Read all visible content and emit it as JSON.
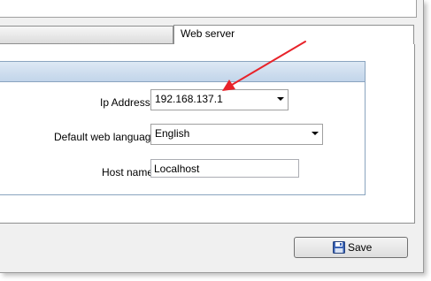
{
  "tabs": [
    {
      "label": ""
    },
    {
      "label": "Web server"
    }
  ],
  "form": {
    "ip_address": {
      "label": "Ip Address",
      "value": "192.168.137.1"
    },
    "default_web_language": {
      "label": "Default web language",
      "value": "English"
    },
    "host_name": {
      "label": "Host name",
      "value": "Localhost"
    }
  },
  "buttons": {
    "save_label": "Save"
  },
  "colors": {
    "annotation_arrow": "#e8232a",
    "group_header": "#c9d9ec",
    "save_icon": "#3a63b5"
  }
}
